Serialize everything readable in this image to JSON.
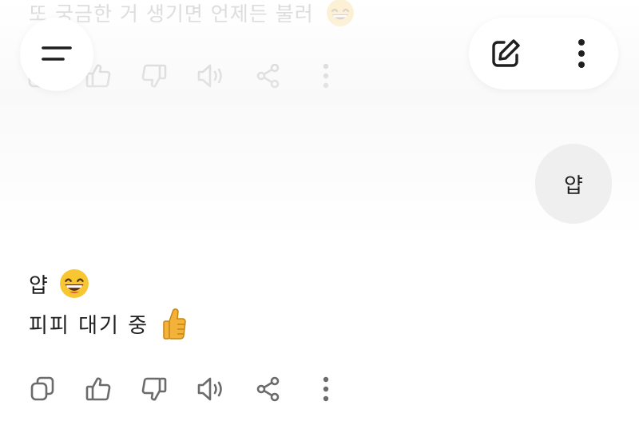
{
  "previous_message": {
    "text": "또 궁금한 거 생기면 언제든 불러",
    "emoji": "grinning-face-emoji"
  },
  "header": {
    "menu_icon": "menu-icon",
    "new_chat_icon": "edit-icon",
    "more_icon": "more-vertical-icon"
  },
  "user_message": {
    "text": "얍"
  },
  "assistant_reply": {
    "line1": "얍",
    "line1_emoji": "grinning-face-emoji",
    "line2": "피피 대기 중",
    "line2_emoji": "thumbs-up-emoji"
  },
  "actions": [
    {
      "icon": "copy-icon"
    },
    {
      "icon": "thumbs-up-icon"
    },
    {
      "icon": "thumbs-down-icon"
    },
    {
      "icon": "read-aloud-icon"
    },
    {
      "icon": "share-icon"
    },
    {
      "icon": "more-vertical-icon"
    }
  ],
  "colors": {
    "text": "#1f1f1f",
    "faded_text": "#c8c8c8",
    "bubble_bg": "#efefef",
    "icon": "#6b6b6b"
  }
}
